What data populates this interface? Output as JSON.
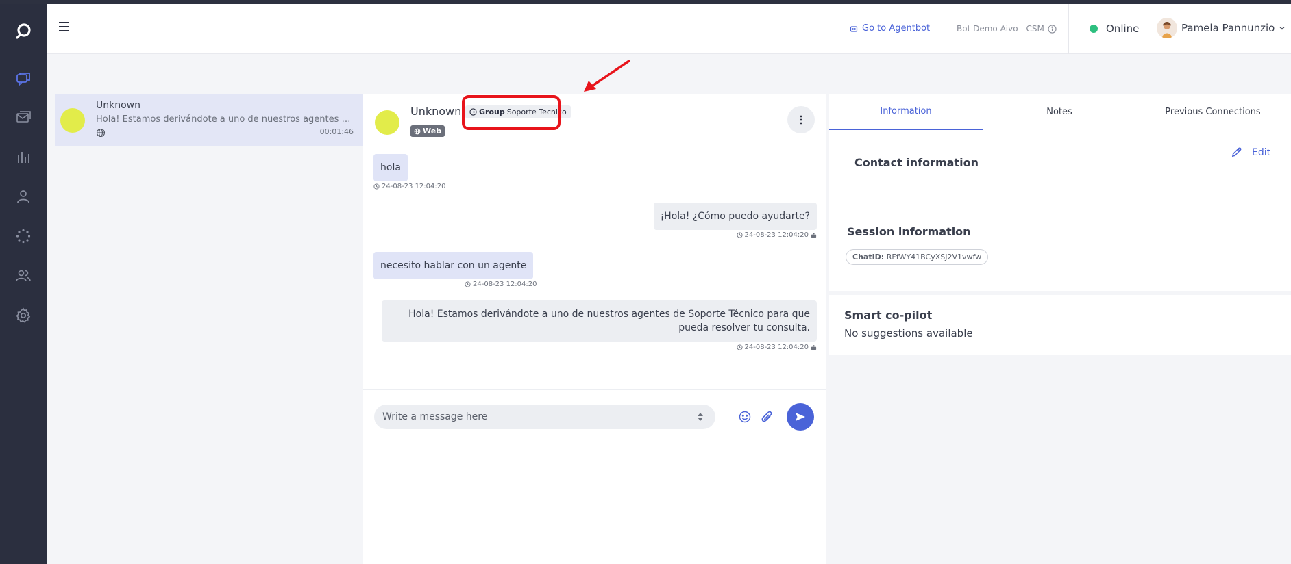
{
  "header": {
    "goto_label": "Go to Agentbot",
    "bot_name": "Bot Demo Aivo - CSM",
    "status": "Online",
    "user_name": "Pamela Pannunzio"
  },
  "sidebar": {
    "items": [
      "chat-icon",
      "inbox-icon",
      "analytics-icon",
      "contact-icon",
      "loading-icon",
      "team-icon",
      "settings-icon"
    ]
  },
  "conversations": [
    {
      "name": "Unknown",
      "preview": "Hola! Estamos derivándote a uno de nuestros agentes de So...",
      "time": "00:01:46"
    }
  ],
  "chat": {
    "contact_name": "Unknown",
    "group_label": "Group",
    "group_name": "Soporte Tecnico",
    "channel": "Web",
    "messages": [
      {
        "direction": "in",
        "text": "hola",
        "timestamp": "24-08-23 12:04:20"
      },
      {
        "direction": "out",
        "text": "¡Hola! ¿Cómo puedo ayudarte?",
        "timestamp": "24-08-23 12:04:20"
      },
      {
        "direction": "in",
        "text": "necesito hablar con un agente",
        "timestamp": "24-08-23 12:04:20"
      },
      {
        "direction": "out",
        "text": "Hola! Estamos derivándote a uno de nuestros agentes de Soporte Técnico para que pueda resolver tu consulta.",
        "timestamp": "24-08-23 12:04:20"
      }
    ],
    "composer_placeholder": "Write a message here"
  },
  "right_panel": {
    "tabs": [
      "Information",
      "Notes",
      "Previous Connections"
    ],
    "active_tab": "Information",
    "contact_title": "Contact information",
    "edit_label": "Edit",
    "session_title": "Session information",
    "chatid_label": "ChatID:",
    "chatid_value": "RFfWY41BCyXSJ2V1vwfw",
    "copilot_title": "Smart co-pilot",
    "copilot_text": "No suggestions available"
  },
  "colors": {
    "accent": "#4a63d8",
    "sidebar": "#2b2f3f",
    "online": "#2dbf7f",
    "avatar": "#e2ec4a",
    "annotation": "#e8141b"
  }
}
